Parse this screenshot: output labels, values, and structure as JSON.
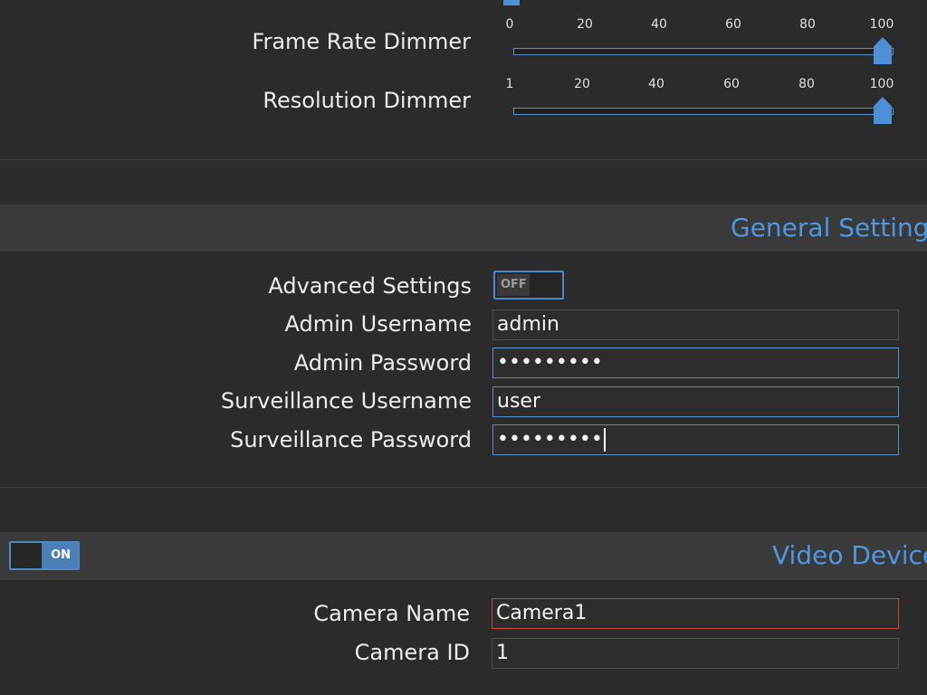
{
  "sliders": {
    "frame_rate": {
      "label": "Frame Rate Dimmer",
      "ticks": [
        "0",
        "20",
        "40",
        "60",
        "80",
        "100"
      ],
      "value": 100
    },
    "resolution": {
      "label": "Resolution Dimmer",
      "ticks": [
        "1",
        "20",
        "40",
        "60",
        "80",
        "100"
      ],
      "value": 100
    }
  },
  "general_settings": {
    "title": "General Settings",
    "advanced_settings": {
      "label": "Advanced Settings",
      "state": "OFF"
    },
    "admin_username": {
      "label": "Admin Username",
      "value": "admin"
    },
    "admin_password": {
      "label": "Admin Password",
      "value": "•••••••••"
    },
    "surveillance_username": {
      "label": "Surveillance Username",
      "value": "user"
    },
    "surveillance_password": {
      "label": "Surveillance Password",
      "value": "•••••••••"
    }
  },
  "video_device": {
    "title": "Video Device",
    "enabled_state": "ON",
    "camera_name": {
      "label": "Camera Name",
      "value": "Camera1"
    },
    "camera_id": {
      "label": "Camera ID",
      "value": "1"
    }
  },
  "colors": {
    "accent": "#4f97e3",
    "background": "#2b2b2b",
    "section_header": "#3a3a3a",
    "error_border": "#c9463a"
  }
}
